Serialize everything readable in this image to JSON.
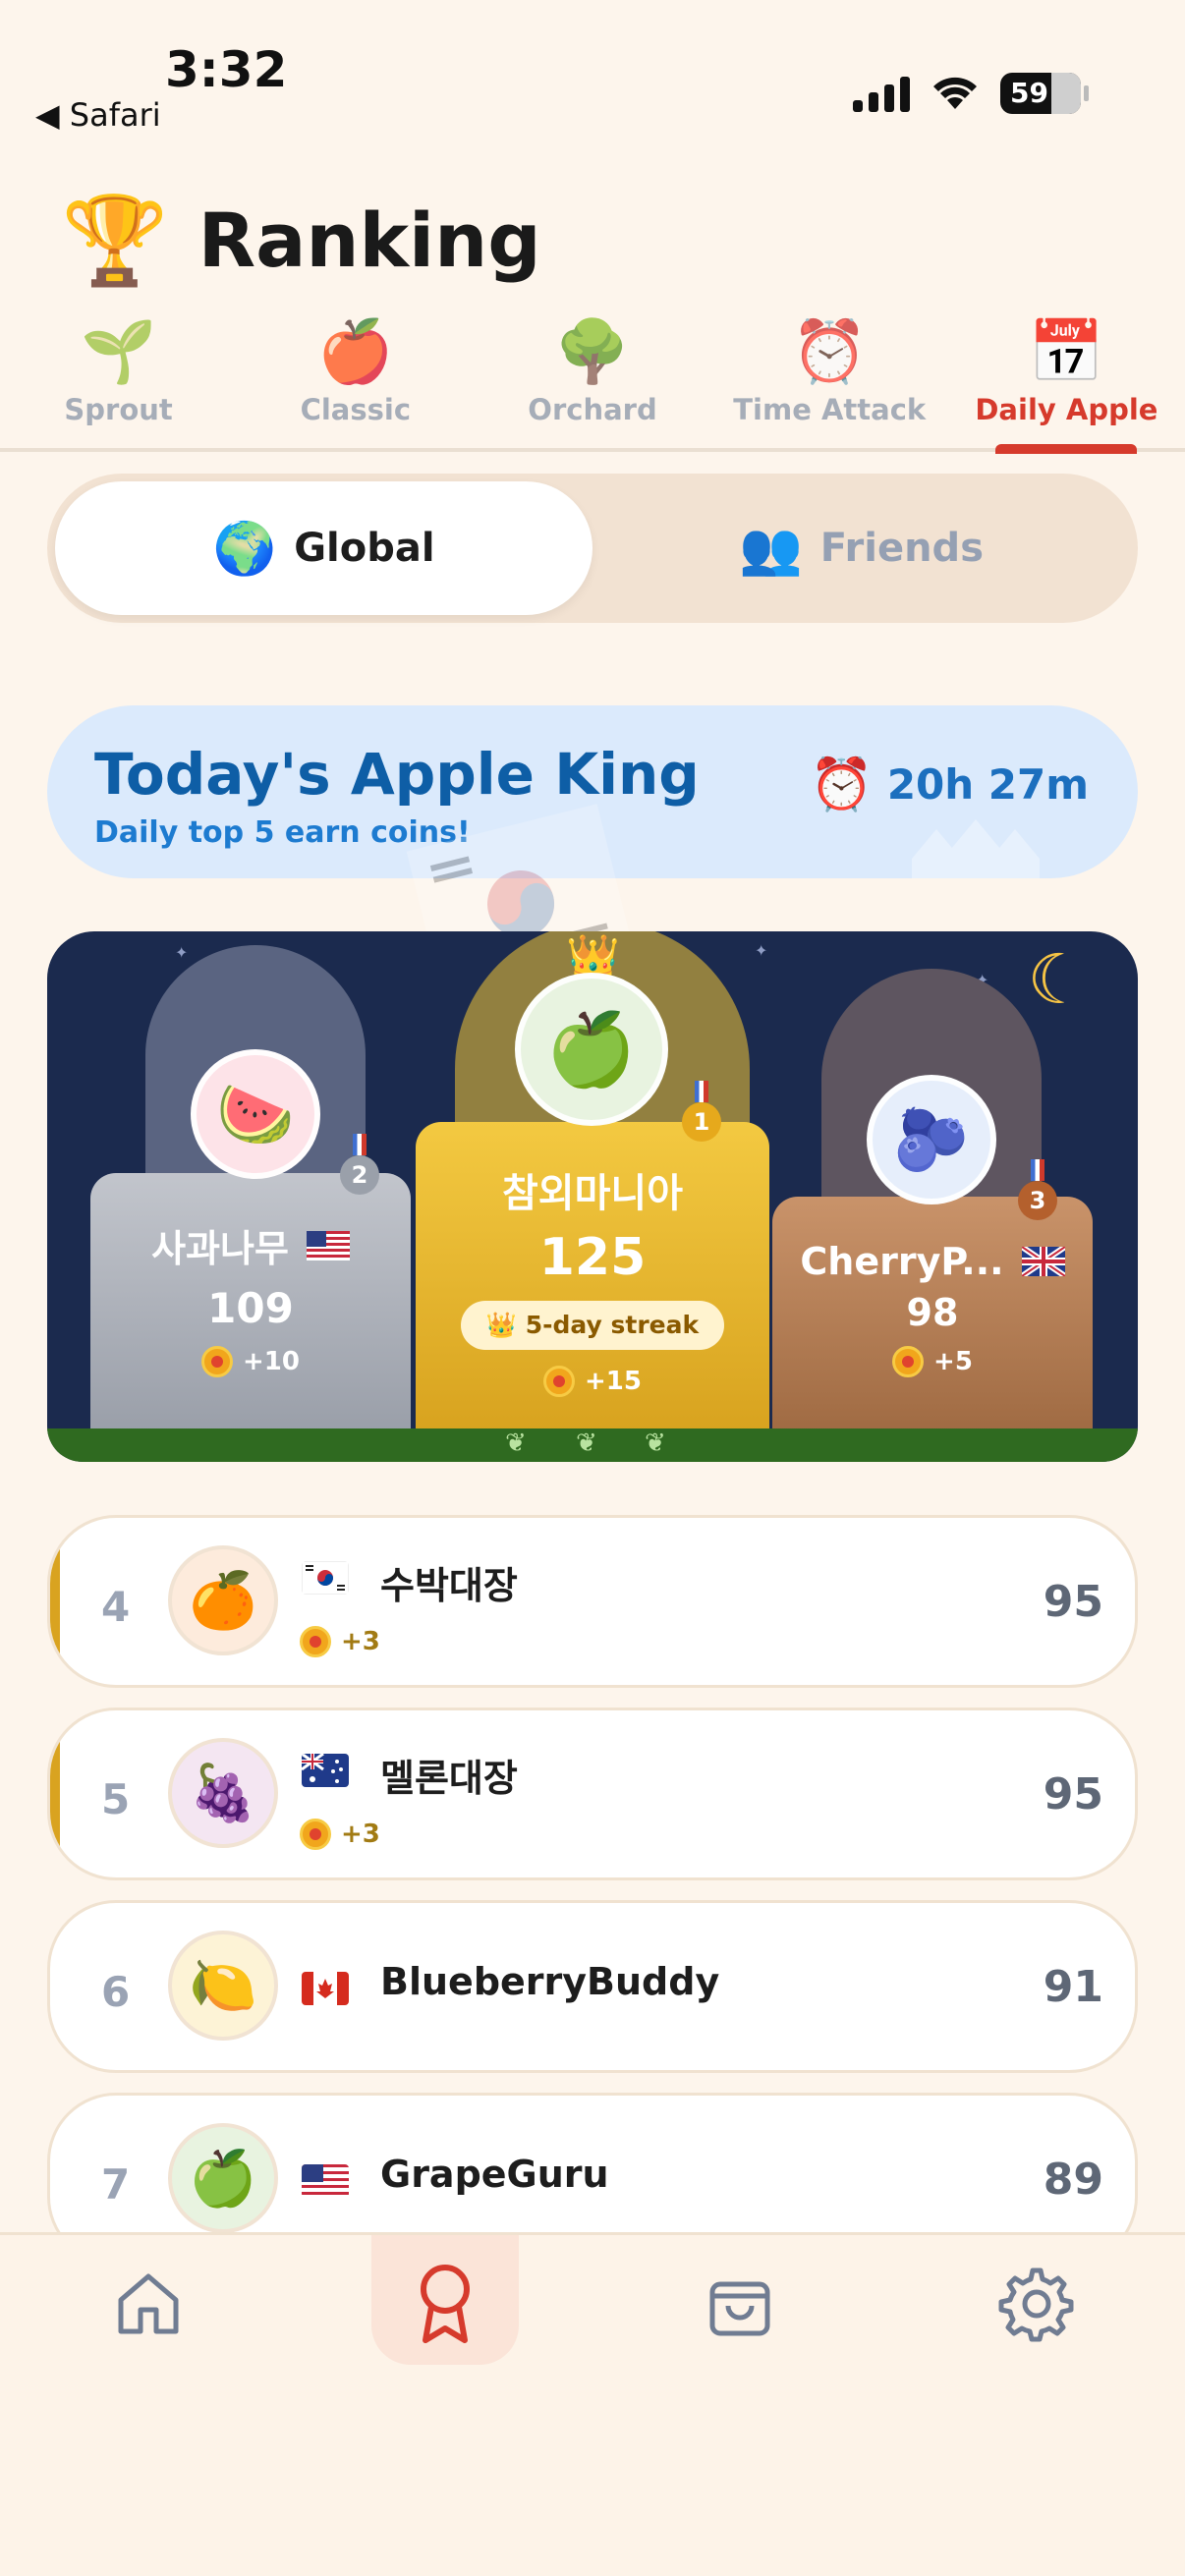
{
  "status_bar": {
    "time": "3:32",
    "back_app": "◀ Safari",
    "battery": "59"
  },
  "header": {
    "title": "Ranking",
    "icon": "trophy-icon"
  },
  "mode_tabs": [
    {
      "label": "Sprout",
      "icon": "sprout-icon",
      "emoji": "🌱",
      "active": false
    },
    {
      "label": "Classic",
      "icon": "apple-icon",
      "emoji": "🍎",
      "active": false
    },
    {
      "label": "Orchard",
      "icon": "tree-icon",
      "emoji": "🌳",
      "active": false
    },
    {
      "label": "Time Attack",
      "icon": "alarm-clock-icon",
      "emoji": "⏰",
      "active": false
    },
    {
      "label": "Daily Apple",
      "icon": "calendar-icon",
      "emoji": "📅",
      "active": true
    }
  ],
  "scope_toggle": {
    "global": {
      "label": "Global",
      "icon": "globe-icon",
      "emoji": "🌍"
    },
    "friends": {
      "label": "Friends",
      "icon": "friends-icon",
      "emoji": "👥"
    },
    "selected": "global"
  },
  "banner": {
    "title": "Today's Apple King",
    "subtitle": "Daily top 5 earn coins!",
    "timer": "20h 27m",
    "timer_icon": "alarm-clock-icon"
  },
  "podium": {
    "first": {
      "rank": "1",
      "name": "참외마니아",
      "score": "125",
      "bonus": "+15",
      "streak": "5-day streak",
      "avatar": "🍏"
    },
    "second": {
      "rank": "2",
      "name": "사과나무",
      "flag": "US",
      "score": "109",
      "bonus": "+10",
      "avatar": "🍉"
    },
    "third": {
      "rank": "3",
      "name": "CherryP...",
      "flag": "GB",
      "score": "98",
      "bonus": "+5",
      "avatar": "🫐"
    }
  },
  "ranking_list": [
    {
      "rank": "4",
      "name": "수박대장",
      "flag": "KR",
      "score": "95",
      "bonus": "+3",
      "avatar": "🍊"
    },
    {
      "rank": "5",
      "name": "멜론대장",
      "flag": "AU",
      "score": "95",
      "bonus": "+3",
      "avatar": "🍇"
    },
    {
      "rank": "6",
      "name": "BlueberryBuddy",
      "flag": "CA",
      "score": "91",
      "avatar": "🍋"
    },
    {
      "rank": "7",
      "name": "GrapeGuru",
      "flag": "US",
      "score": "89",
      "avatar": "🍏"
    }
  ],
  "bottom_nav": [
    {
      "icon": "home-icon",
      "active": false
    },
    {
      "icon": "ranking-ribbon-icon",
      "active": true
    },
    {
      "icon": "shop-bag-icon",
      "active": false
    },
    {
      "icon": "settings-gear-icon",
      "active": false
    }
  ],
  "colors": {
    "background": "#fdf5ec",
    "accent_red": "#d63a2c",
    "banner_blue": "#0e5ea6",
    "gold": "#d9a320",
    "podium_night": "#1b2a4e"
  }
}
